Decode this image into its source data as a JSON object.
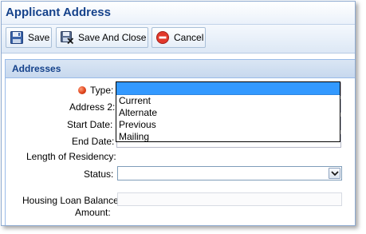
{
  "window": {
    "title": "Applicant Address"
  },
  "toolbar": {
    "save_label": "Save",
    "save_close_label": "Save And Close",
    "cancel_label": "Cancel",
    "save_icon": "floppy-disk-icon",
    "save_close_icon": "floppy-disk-close-icon",
    "cancel_icon": "cancel-circle-icon"
  },
  "panel": {
    "title": "Addresses"
  },
  "form": {
    "type_label": "Type:",
    "address2_label": "Address 2:",
    "start_date_label": "Start Date:",
    "end_date_label": "End Date:",
    "length_label": "Length of Residency:",
    "status_label": "Status:",
    "loan_balance_label": "Housing Loan Balance",
    "loan_balance_label2": "Amount:",
    "type_value": "",
    "status_value": ""
  },
  "type_dropdown": {
    "options": [
      "Current",
      "Alternate",
      "Previous",
      "Mailing"
    ]
  },
  "colors": {
    "title_text": "#15428b",
    "selection_highlight": "#3399ff",
    "required_indicator": "#e0441c"
  }
}
